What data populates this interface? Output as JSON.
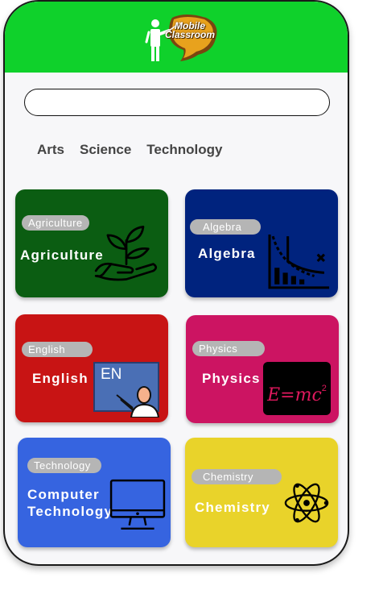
{
  "app": {
    "logo_text_line1": "Mobile",
    "logo_text_line2": "Classroom"
  },
  "search": {
    "value": "",
    "placeholder": ""
  },
  "tabs": [
    {
      "label": "Arts"
    },
    {
      "label": "Science"
    },
    {
      "label": "Technology"
    }
  ],
  "cards": [
    {
      "badge": "Agriculture",
      "title": "Agriculture",
      "color": "#0b5d12",
      "icon": "plant-in-hand-icon"
    },
    {
      "badge": "Algebra",
      "title": "Algebra",
      "color": "#00237e",
      "icon": "graph-chart-icon"
    },
    {
      "badge": "English",
      "title": "English",
      "color": "#c81414",
      "icon": "english-teacher-board-icon"
    },
    {
      "badge": "Physics",
      "title": "Physics",
      "color": "#cc1462",
      "icon": "emc2-formula-icon"
    },
    {
      "badge": "Technology",
      "title_line1": "Computer",
      "title_line2": "Technology",
      "color": "#3664e0",
      "icon": "computer-monitor-icon"
    },
    {
      "badge": "Chemistry",
      "title": "Chemistry",
      "color": "#e9d32a",
      "icon": "atom-icon"
    }
  ],
  "icons": {
    "english_board_text": "EN",
    "physics_formula": "E=mc",
    "physics_exponent": "2"
  }
}
